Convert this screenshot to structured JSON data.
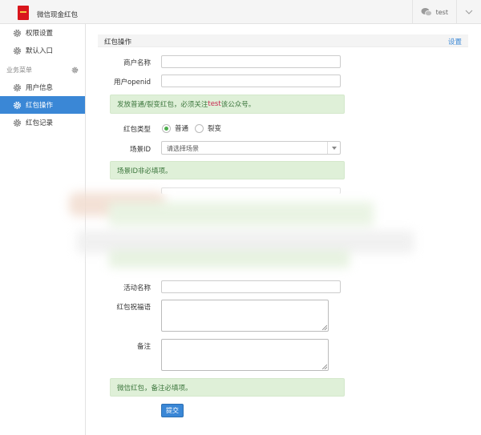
{
  "header": {
    "app_title": "微信现金红包",
    "username": "test",
    "icons": {
      "logo": "app-logo",
      "wechat": "wechat-icon",
      "dropdown": "chevron-down-icon"
    }
  },
  "sidebar": {
    "items_top": [
      {
        "label": "权限设置",
        "icon": "gear-icon"
      },
      {
        "label": "默认入口",
        "icon": "gear-icon"
      }
    ],
    "section_header": "业务菜单",
    "items_business": [
      {
        "label": "用户信息",
        "icon": "gear-icon",
        "active": false
      },
      {
        "label": "红包操作",
        "icon": "gear-icon",
        "active": true
      },
      {
        "label": "红包记录",
        "icon": "gear-icon",
        "active": false
      }
    ]
  },
  "panel": {
    "title": "红包操作",
    "settings_link": "设置"
  },
  "form": {
    "merchant_label": "商户名称",
    "merchant_value": "",
    "openid_label": "用户openid",
    "openid_value": "",
    "alert1_prefix": "发放普通/裂变红包，必须关注",
    "alert1_highlight": "test",
    "alert1_suffix": "该公众号。",
    "type_label": "红包类型",
    "type_options": [
      "普通",
      "裂变"
    ],
    "type_selected": "普通",
    "scene_label": "场景ID",
    "scene_selected": "请选择场景",
    "alert2": "场景ID非必填项。",
    "activity_label": "活动名称",
    "activity_value": "",
    "wishing_label": "红包祝福语",
    "remark_label": "备注",
    "alert3": "微信红包，备注必填项。",
    "submit_label": "提交"
  },
  "colors": {
    "accent": "#3a87d6",
    "alert_bg": "#dff0d8",
    "alert_text": "#3c763d",
    "highlight": "#c7254e",
    "brand_red": "#d9161c"
  }
}
